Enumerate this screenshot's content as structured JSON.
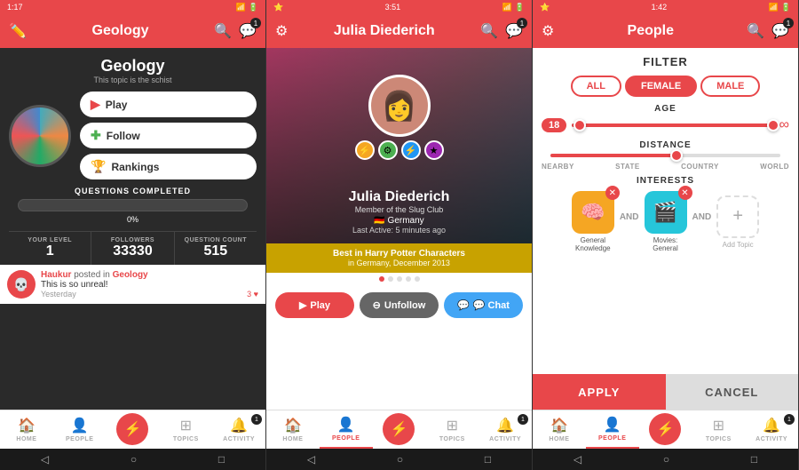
{
  "screen1": {
    "status": {
      "time": "1:17",
      "icons": "📶🔋"
    },
    "header": {
      "title": "Geology",
      "edit_icon": "✏️",
      "search_icon": "🔍",
      "chat_icon": "💬",
      "chat_badge": "1"
    },
    "hero": {
      "title": "Geology",
      "subtitle": "This topic is the schist"
    },
    "buttons": {
      "play": "Play",
      "follow": "Follow",
      "rankings": "Rankings"
    },
    "progress": {
      "label": "QUESTIONS COMPLETED",
      "value": "0%"
    },
    "stats": {
      "level_label": "YOUR LEVEL",
      "level_value": "1",
      "followers_label": "FOLLOWERS",
      "followers_value": "33330",
      "questions_label": "QUESTION COUNT",
      "questions_value": "515"
    },
    "post": {
      "author": "Haukur",
      "action": " posted in ",
      "topic": "Geology",
      "text": "This is so unreal!",
      "time": "Yesterday",
      "likes": "3 ♥"
    },
    "nav": {
      "home": "HOME",
      "people": "PEOPLE",
      "topics": "TOPICS",
      "activity": "ACTIVITY",
      "badge": "1"
    }
  },
  "screen2": {
    "status": {
      "time": "3:51"
    },
    "header": {
      "title": "Julia Diederich",
      "search_icon": "🔍",
      "chat_badge": "1"
    },
    "profile": {
      "name": "Julia Diederich",
      "club": "Member of the Slug Club",
      "country": "Germany",
      "active": "Last Active: 5 minutes ago",
      "best_title": "Best in Harry Potter Characters",
      "best_sub": "in Germany, December 2013"
    },
    "buttons": {
      "play": "▶ Play",
      "unfollow": "⊖ Unfollow",
      "chat": "💬 Chat"
    }
  },
  "screen3": {
    "status": {
      "time": "1:42"
    },
    "header": {
      "title": "People",
      "search_icon": "🔍",
      "chat_badge": "1"
    },
    "filter": {
      "title": "FILTER",
      "gender_all": "ALL",
      "gender_female": "FEMALE",
      "gender_male": "MALE",
      "age_label": "AGE",
      "age_min": "18",
      "age_max": "∞",
      "distance_label": "DISTANCE",
      "distance_options": [
        "NEARBY",
        "STATE",
        "COUNTRY",
        "WORLD"
      ],
      "interests_label": "INTERESTS",
      "interest1_name": "General\nKnowledge",
      "interest2_name": "Movies:\nGeneral",
      "add_topic": "Add Topic",
      "apply": "APPLY",
      "cancel": "CANCEL"
    }
  }
}
